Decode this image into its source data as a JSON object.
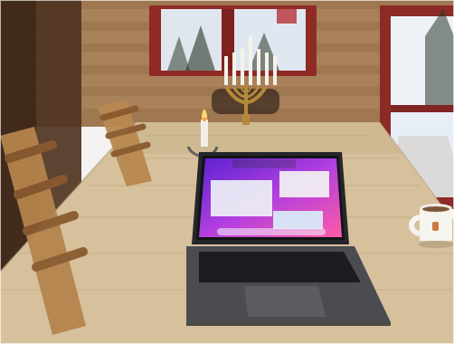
{
  "scene": {
    "description_tags": [
      "cabin-interior",
      "wooden-table",
      "laptop",
      "candle",
      "menorah",
      "coffee-mug",
      "window"
    ],
    "colors": {
      "wall_log": "#a07a52",
      "wall_dark": "#5b3f28",
      "window_frame": "#9a2f2a",
      "table": "#d7c3a1",
      "table_shadow": "#b69f7c",
      "chair": "#b98a54",
      "laptop_body": "#3b3d42",
      "laptop_keys": "#1f2023",
      "screen_wallpaper_a": "#6a2bd6",
      "screen_wallpaper_b": "#e24aa0",
      "snow": "#dfe6ee",
      "mug": "#f6f4ef",
      "brass": "#b48a3a"
    },
    "icons": [
      "menorah-icon",
      "candle-icon",
      "laptop-icon",
      "mug-icon",
      "window-icon",
      "chair-icon"
    ]
  }
}
